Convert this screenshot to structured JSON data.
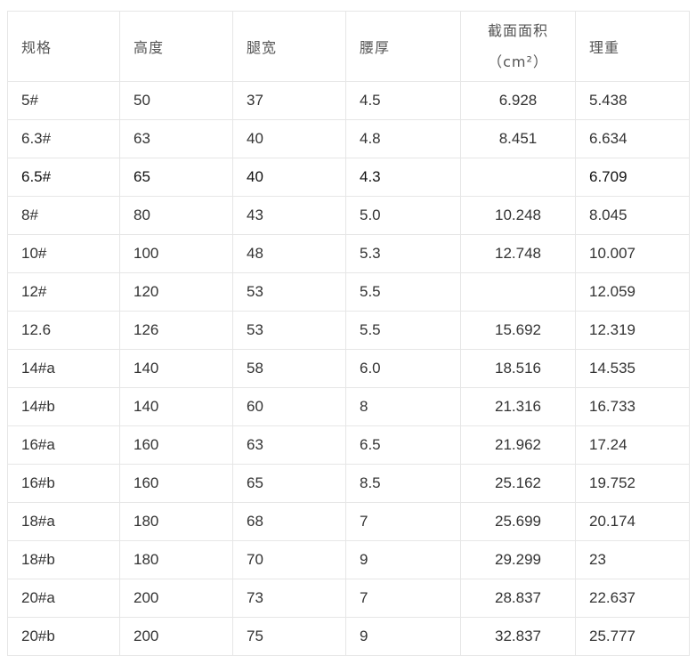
{
  "table": {
    "headers": {
      "spec": "规格",
      "height": "高度",
      "leg_width": "腿宽",
      "waist_thickness": "腰厚",
      "area_line1": "截面面积",
      "area_line2": "（cm²）",
      "unit_weight": "理重"
    },
    "rows": [
      {
        "spec": "5#",
        "height": "50",
        "leg_width": "37",
        "waist": "4.5",
        "area": "6.928",
        "weight": "5.438"
      },
      {
        "spec": "6.3#",
        "height": "63",
        "leg_width": "40",
        "waist": "4.8",
        "area": "8.451",
        "weight": "6.634"
      },
      {
        "spec": "6.5#",
        "height": "65",
        "leg_width": "40",
        "waist": "4.3",
        "area": "",
        "weight": "6.709"
      },
      {
        "spec": "8#",
        "height": "80",
        "leg_width": "43",
        "waist": "5.0",
        "area": "10.248",
        "weight": "8.045"
      },
      {
        "spec": "10#",
        "height": "100",
        "leg_width": "48",
        "waist": "5.3",
        "area": "12.748",
        "weight": "10.007"
      },
      {
        "spec": "12#",
        "height": "120",
        "leg_width": "53",
        "waist": "5.5",
        "area": "",
        "weight": "12.059"
      },
      {
        "spec": "12.6",
        "height": "126",
        "leg_width": "53",
        "waist": "5.5",
        "area": "15.692",
        "weight": "12.319"
      },
      {
        "spec": "14#a",
        "height": "140",
        "leg_width": "58",
        "waist": "6.0",
        "area": "18.516",
        "weight": "14.535"
      },
      {
        "spec": "14#b",
        "height": "140",
        "leg_width": "60",
        "waist": "8",
        "area": "21.316",
        "weight": "16.733"
      },
      {
        "spec": "16#a",
        "height": "160",
        "leg_width": "63",
        "waist": "6.5",
        "area": "21.962",
        "weight": "17.24"
      },
      {
        "spec": "16#b",
        "height": "160",
        "leg_width": "65",
        "waist": "8.5",
        "area": "25.162",
        "weight": "19.752"
      },
      {
        "spec": "18#a",
        "height": "180",
        "leg_width": "68",
        "waist": "7",
        "area": "25.699",
        "weight": "20.174"
      },
      {
        "spec": "18#b",
        "height": "180",
        "leg_width": "70",
        "waist": "9",
        "area": "29.299",
        "weight": "23"
      },
      {
        "spec": "20#a",
        "height": "200",
        "leg_width": "73",
        "waist": "7",
        "area": "28.837",
        "weight": "22.637"
      },
      {
        "spec": "20#b",
        "height": "200",
        "leg_width": "75",
        "waist": "9",
        "area": "32.837",
        "weight": "25.777"
      }
    ]
  }
}
